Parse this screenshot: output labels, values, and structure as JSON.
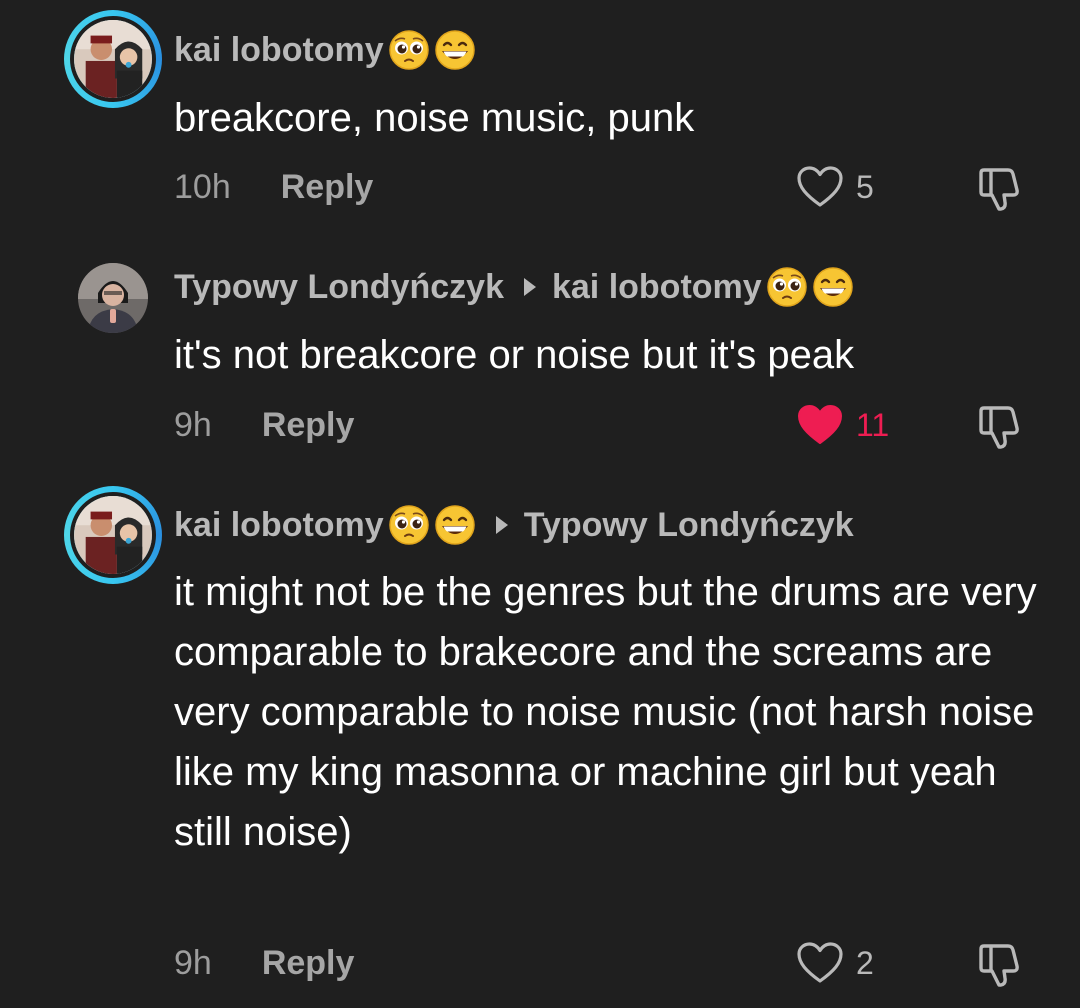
{
  "comments": [
    {
      "author": "kai lobotomy",
      "reply_to": "",
      "text": "breakcore, noise music, punk",
      "time": "10h",
      "reply_label": "Reply",
      "likes": "5",
      "liked": false,
      "avatar_ring": true
    },
    {
      "author": "Typowy Londyńczyk",
      "reply_to": "kai lobotomy",
      "text": "it's not breakcore or noise but it's peak",
      "time": "9h",
      "reply_label": "Reply",
      "likes": "11",
      "liked": true,
      "avatar_ring": false
    },
    {
      "author": "kai lobotomy",
      "reply_to": "Typowy Londyńczyk",
      "text": "it might not be the genres but the drums are very comparable to brakecore and the screams are very comparable to noise music (not harsh noise like my king masonna or machine girl but yeah still noise)",
      "time": "9h",
      "reply_label": "Reply",
      "likes": "2",
      "liked": false,
      "avatar_ring": true
    }
  ],
  "colors": {
    "background": "#1f1f1f",
    "like_active": "#ee1d52",
    "story_ring": "#38c7f0",
    "muted_text": "#b9b9b9"
  },
  "icons": {
    "heart": "heart-outline-icon",
    "heart_active": "heart-filled-icon",
    "dislike": "thumbs-down-icon",
    "emoji_1": "pleading-face-emoji",
    "emoji_2": "grinning-face-emoji"
  }
}
